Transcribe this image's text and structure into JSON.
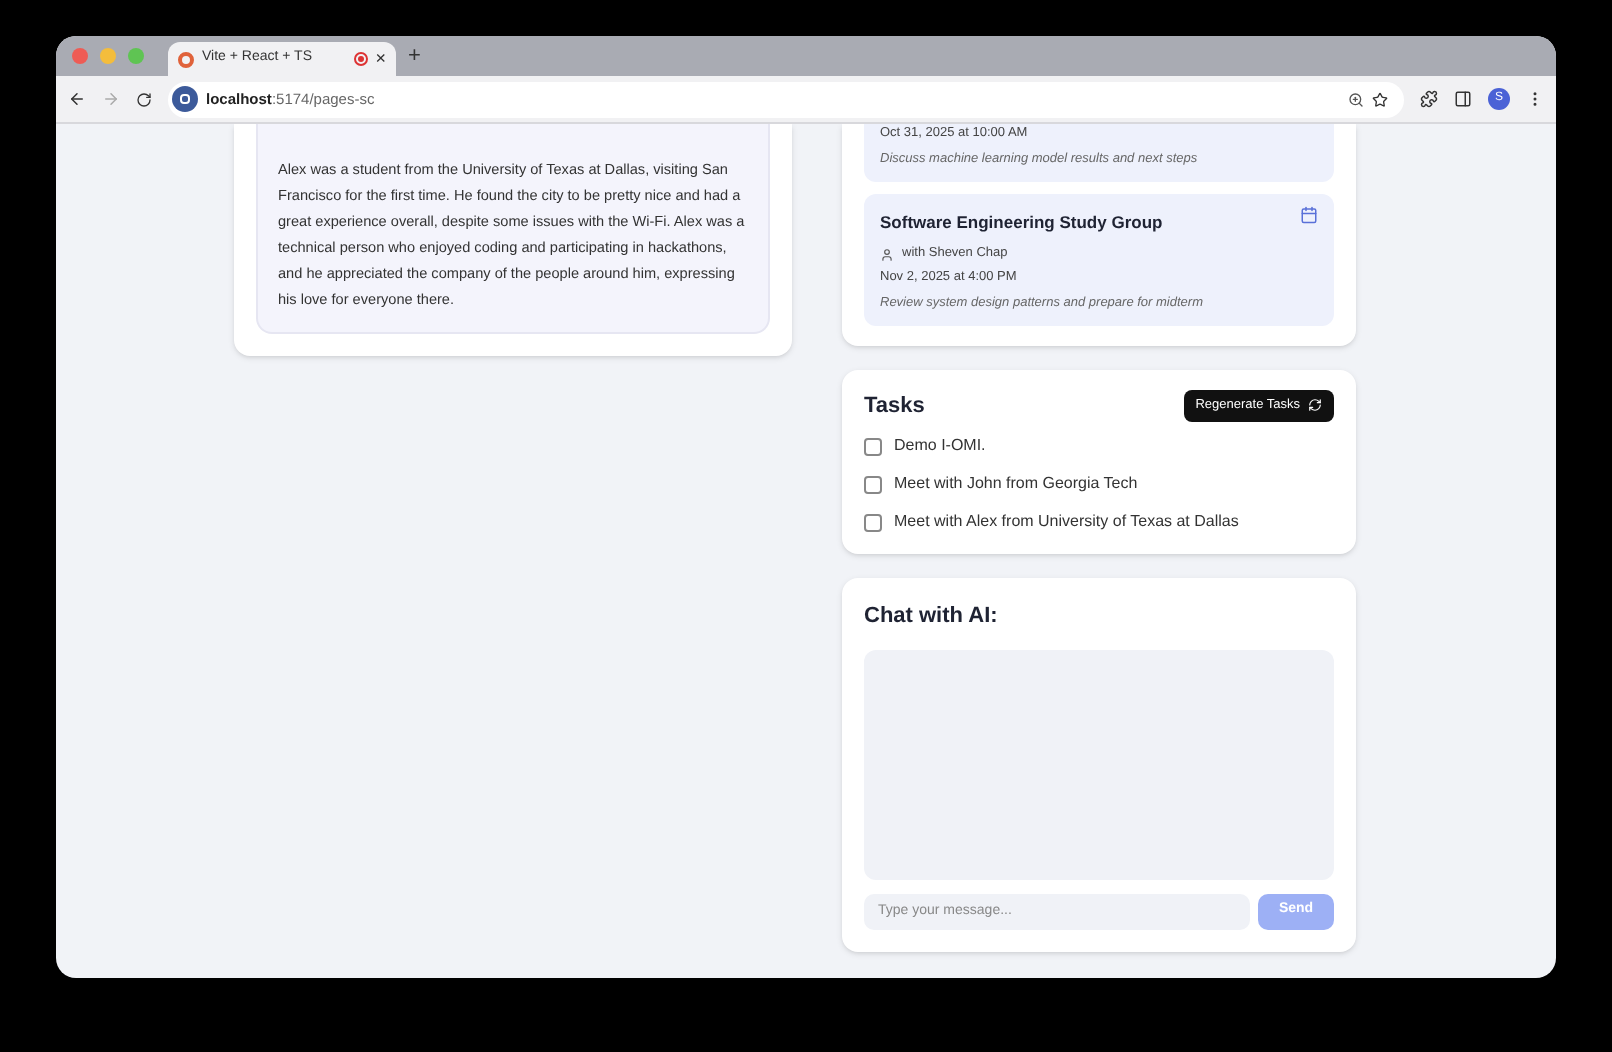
{
  "browser": {
    "tab_title": "Vite + React + TS",
    "close_label": "×",
    "new_tab_label": "+",
    "url_host": "localhost",
    "url_path": ":5174/pages-sc",
    "profile_initial": "S"
  },
  "summary": {
    "text": "Alex was a student from the University of Texas at Dallas, visiting San Francisco for the first time. He found the city to be pretty nice and had a great experience overall, despite some issues with the Wi-Fi. Alex was a technical person who enjoyed coding and participating in hackathons, and he appreciated the company of the people around him, expressing his love for everyone there."
  },
  "events": [
    {
      "kind": "partial",
      "when": "Oct 31, 2025 at 10:00 AM",
      "description": "Discuss machine learning model results and next steps"
    },
    {
      "kind": "full",
      "title": "Software Engineering Study Group",
      "with": "with Sheven Chap",
      "when": "Nov 2, 2025 at 4:00 PM",
      "description": "Review system design patterns and prepare for midterm"
    }
  ],
  "tasks": {
    "title": "Tasks",
    "regenerate_label": "Regenerate Tasks",
    "items": [
      {
        "label": "Demo I-OMI.",
        "checked": false
      },
      {
        "label": "Meet with John from Georgia Tech",
        "checked": false
      },
      {
        "label": "Meet with Alex from University of Texas at Dallas",
        "checked": false
      }
    ]
  },
  "chat": {
    "title": "Chat with AI:",
    "placeholder": "Type your message...",
    "send_label": "Send",
    "send_disabled": true
  }
}
